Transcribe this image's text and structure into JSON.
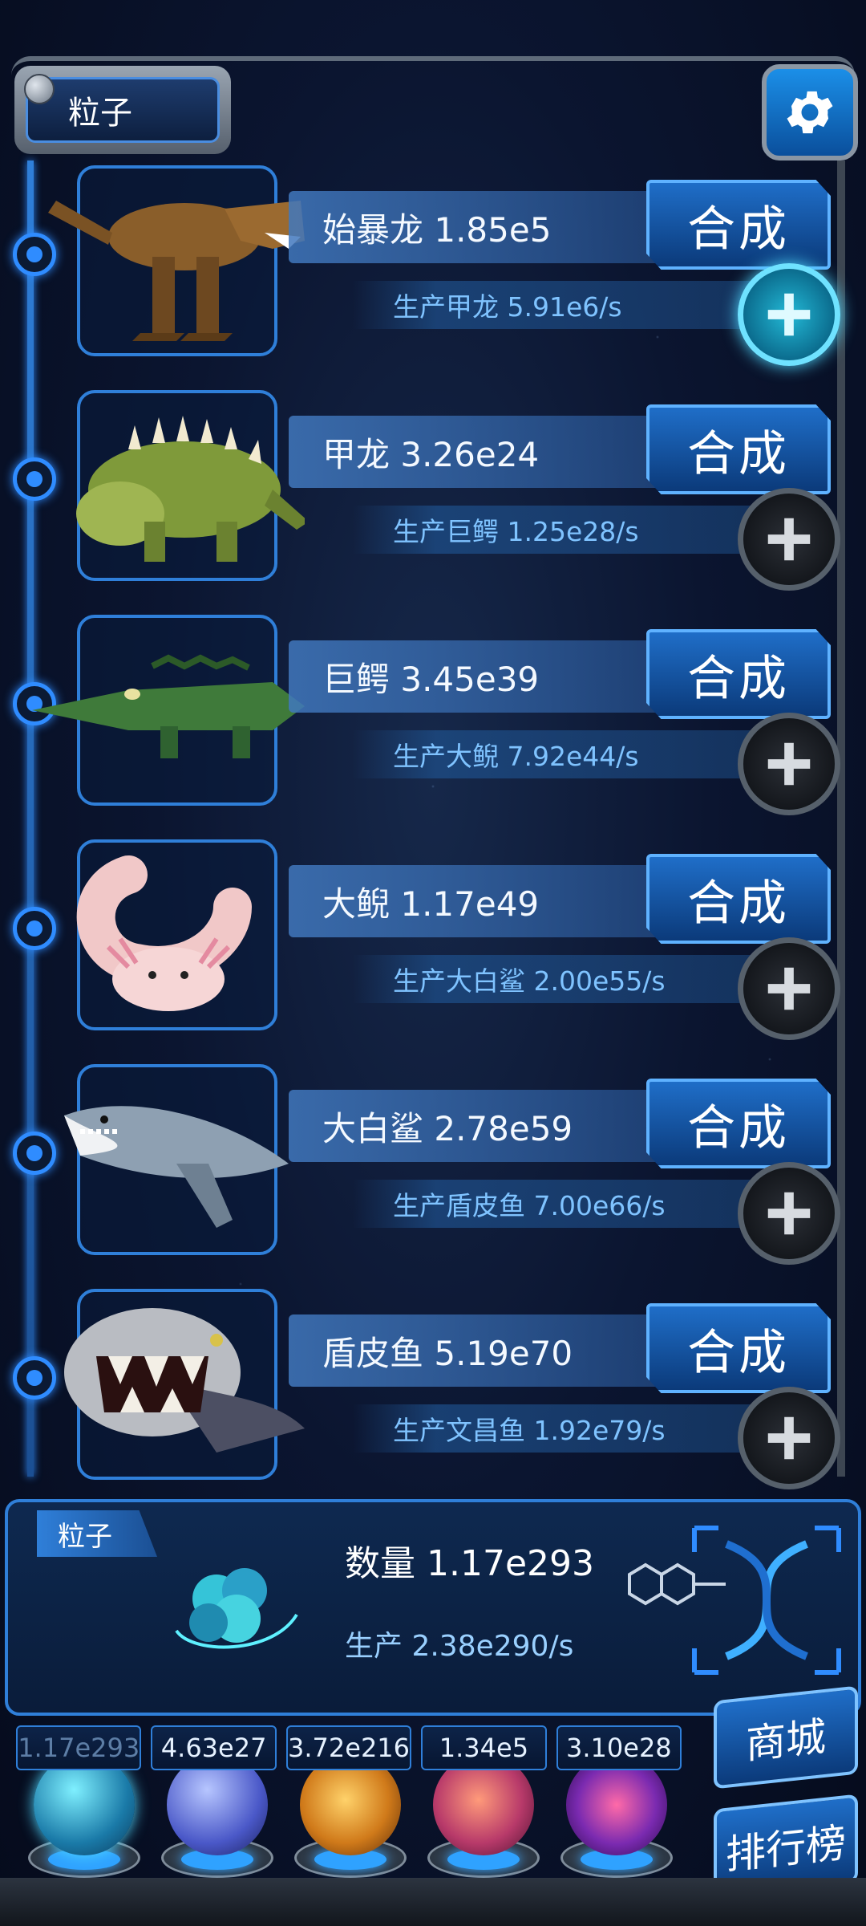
{
  "header": {
    "title": "粒子"
  },
  "merge_label": "合成",
  "creatures": [
    {
      "name": "始暴龙 1.85e5",
      "production": "生产甲龙 5.91e6/s",
      "icon": "t-rex-icon",
      "plus_active": true
    },
    {
      "name": "甲龙 3.26e24",
      "production": "生产巨鳄 1.25e28/s",
      "icon": "ankylosaurus-icon",
      "plus_active": false
    },
    {
      "name": "巨鳄 3.45e39",
      "production": "生产大鲵 7.92e44/s",
      "icon": "crocodile-icon",
      "plus_active": false
    },
    {
      "name": "大鲵 1.17e49",
      "production": "生产大白鲨 2.00e55/s",
      "icon": "salamander-icon",
      "plus_active": false
    },
    {
      "name": "大白鲨 2.78e59",
      "production": "生产盾皮鱼 7.00e66/s",
      "icon": "shark-icon",
      "plus_active": false
    },
    {
      "name": "盾皮鱼 5.19e70",
      "production": "生产文昌鱼 1.92e79/s",
      "icon": "dunkleosteus-icon",
      "plus_active": false
    }
  ],
  "particle_panel": {
    "tag": "粒子",
    "quantity": "数量 1.17e293",
    "production": "生产 2.38e290/s"
  },
  "resources": [
    "1.17e293",
    "4.63e27",
    "3.72e216",
    "1.34e5",
    "3.10e28"
  ],
  "side_buttons": {
    "shop": "商城",
    "ranking": "排行榜"
  },
  "colors": {
    "accent": "#2f8cff",
    "panel": "#0e2950",
    "active_plus": "#23b9d6"
  }
}
